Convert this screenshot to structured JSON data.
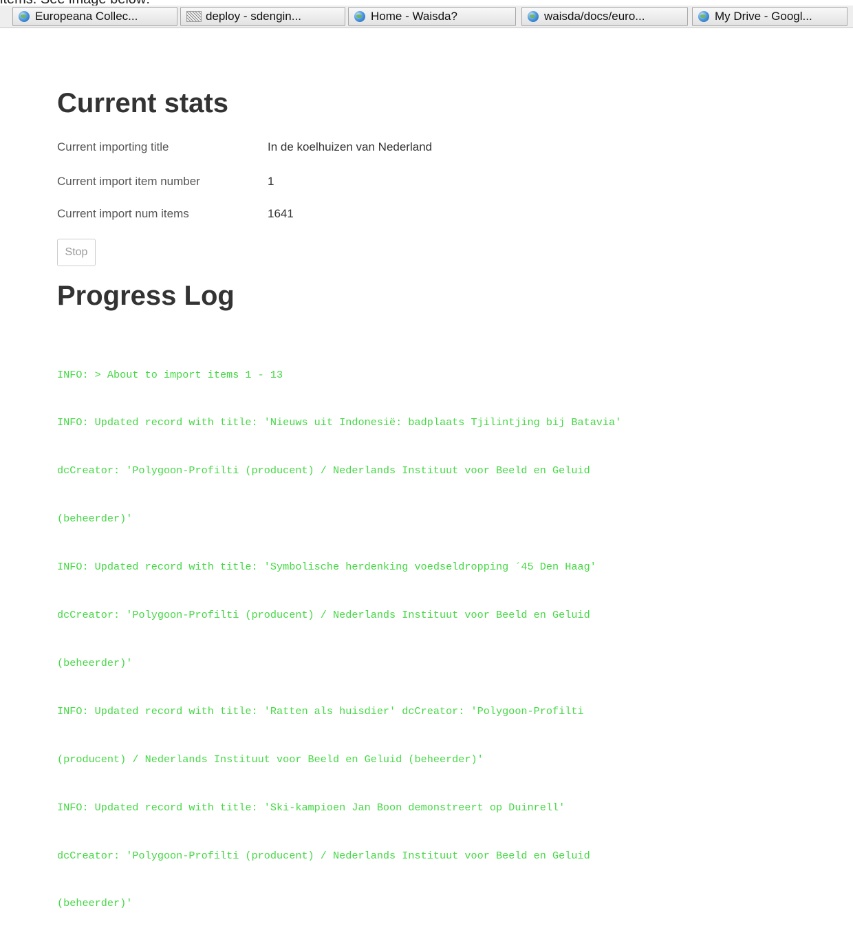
{
  "page_top_text": "items. See image below:",
  "tabs": [
    {
      "label": "Europeana Collec...",
      "icon": "globe-icon"
    },
    {
      "label": "deploy - sdengin...",
      "icon": "hatched-page-icon"
    },
    {
      "label": "Home - Waisda?",
      "icon": "globe-icon"
    },
    {
      "label": "waisda/docs/euro...",
      "icon": "globe-icon"
    },
    {
      "label": "My Drive - Googl...",
      "icon": "globe-icon"
    }
  ],
  "stats": {
    "heading": "Current stats",
    "rows": [
      {
        "label": "Current importing title",
        "value": "In de koelhuizen van Nederland"
      },
      {
        "label": "Current import item number",
        "value": "1"
      },
      {
        "label": "Current import num items",
        "value": "1641"
      }
    ],
    "stop_label": "Stop"
  },
  "log": {
    "heading": "Progress Log",
    "lines": [
      "INFO: > About to import items 1 - 13",
      "INFO: Updated record with title: 'Nieuws uit Indonesië: badplaats Tjilintjing bij Batavia'",
      "dcCreator: 'Polygoon-Profilti (producent) / Nederlands Instituut voor Beeld en Geluid",
      "(beheerder)'",
      "INFO: Updated record with title: 'Symbolische herdenking voedseldropping ´45 Den Haag'",
      "dcCreator: 'Polygoon-Profilti (producent) / Nederlands Instituut voor Beeld en Geluid",
      "(beheerder)'",
      "INFO: Updated record with title: 'Ratten als huisdier' dcCreator: 'Polygoon-Profilti",
      "(producent) / Nederlands Instituut voor Beeld en Geluid (beheerder)'",
      "INFO: Updated record with title: 'Ski-kampioen Jan Boon demonstreert op Duinrell'",
      "dcCreator: 'Polygoon-Profilti (producent) / Nederlands Instituut voor Beeld en Geluid",
      "(beheerder)'"
    ]
  },
  "colors": {
    "log_text": "#44d844",
    "heading_text": "#333333",
    "label_text": "#555555",
    "tab_border": "#a8a8a8"
  }
}
